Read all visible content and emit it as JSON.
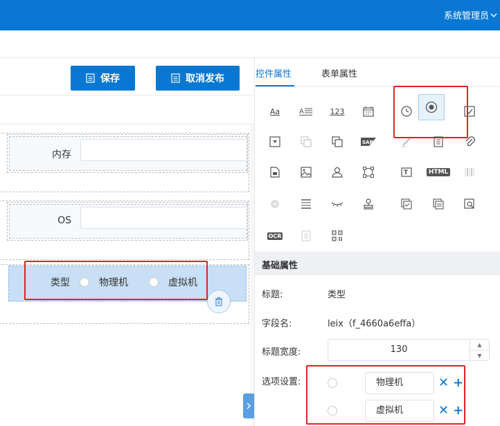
{
  "header": {
    "user_label": "系统管理员"
  },
  "toolbar": {
    "save_label": "保存",
    "unpublish_label": "取消发布"
  },
  "form": {
    "fields": [
      {
        "label": "内存",
        "value": ""
      },
      {
        "label": "OS",
        "value": ""
      }
    ],
    "radio_field": {
      "label": "类型",
      "options": [
        "物理机",
        "虚拟机"
      ]
    }
  },
  "panel": {
    "tabs": [
      "控件属性",
      "表单属性"
    ],
    "icons": [
      "text-icon",
      "textarea-icon",
      "number-icon",
      "date-icon",
      "time-icon",
      "radio-icon",
      "checkbox-icon",
      "select-icon",
      "multi-select-icon",
      "cascade-icon",
      "sap-icon",
      "signature-icon",
      "document-icon",
      "attachment-icon",
      "file-icon",
      "image-icon",
      "user-icon",
      "org-icon",
      "title-icon",
      "html-icon",
      "barcode-icon",
      "dot-icon",
      "divider-icon",
      "eye-icon",
      "stamp-icon",
      "sub-form-icon",
      "grid-icon",
      "query-icon",
      "ocr-icon",
      "page-icon",
      "qrcode-icon"
    ],
    "icon_text": {
      "number": "123",
      "html": "HTML",
      "ocr": "OCR",
      "sap": "SAP",
      "text": "Aa"
    },
    "section_title": "基础属性",
    "props": {
      "title_label": "标题:",
      "title_value": "类型",
      "field_label": "字段名:",
      "field_value": "leix（f_4660a6effa）",
      "width_label": "标题宽度:",
      "width_value": "130",
      "options_label": "选项设置:"
    },
    "options": [
      "物理机",
      "虚拟机"
    ]
  },
  "colors": {
    "primary": "#0a78d2",
    "highlight": "#e32020"
  }
}
